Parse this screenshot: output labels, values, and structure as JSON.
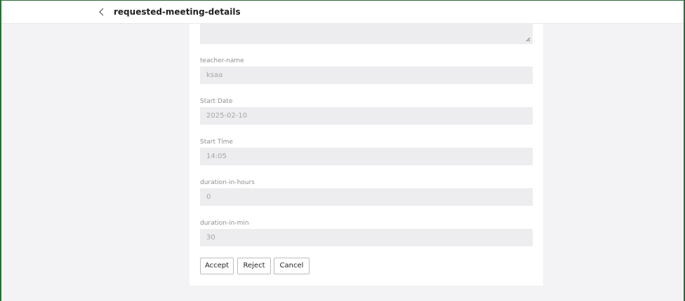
{
  "header": {
    "back_icon": "chevron-left-icon",
    "title": "requested-meeting-details"
  },
  "form": {
    "description": {
      "value": ""
    },
    "teacher_name": {
      "label": "teacher-name",
      "value": "ksaa"
    },
    "start_date": {
      "label": "Start Date",
      "value": "2025-02-10"
    },
    "start_time": {
      "label": "Start Time",
      "value": "14:05"
    },
    "duration_hours": {
      "label": "duration-in-hours",
      "value": "0"
    },
    "duration_min": {
      "label": "duration-in-min",
      "value": "30"
    }
  },
  "actions": {
    "accept": "Accept",
    "reject": "Reject",
    "cancel": "Cancel"
  },
  "colors": {
    "frame_border": "#2e6b3a",
    "page_background": "#f3f3f5",
    "input_background": "#ededf0"
  }
}
